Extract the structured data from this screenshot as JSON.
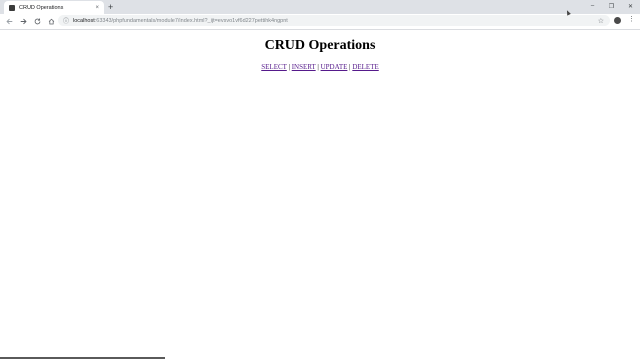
{
  "browser": {
    "tab_title": "CRUD Operations",
    "new_tab_symbol": "+",
    "close_symbol": "×",
    "url_host": "localhost",
    "url_path": ":63343/phpfundamentals/module7/index.html?_ijt=evsvo1vf6d227pettihk4ngpnt",
    "controls": {
      "minimize": "–",
      "maximize": "❐",
      "close": "✕"
    },
    "icons": {
      "back": "back-arrow-icon",
      "forward": "forward-arrow-icon",
      "reload": "reload-icon",
      "home": "home-icon",
      "info": "info-icon",
      "star": "star-icon",
      "menu": "menu-icon"
    }
  },
  "page": {
    "title": "CRUD Operations",
    "links": [
      "SELECT",
      "INSERT",
      "UPDATE",
      "DELETE"
    ],
    "separator": "|"
  },
  "colors": {
    "link": "#551a8b",
    "tabstrip": "#dee1e6",
    "omnibox": "#f1f3f4"
  }
}
